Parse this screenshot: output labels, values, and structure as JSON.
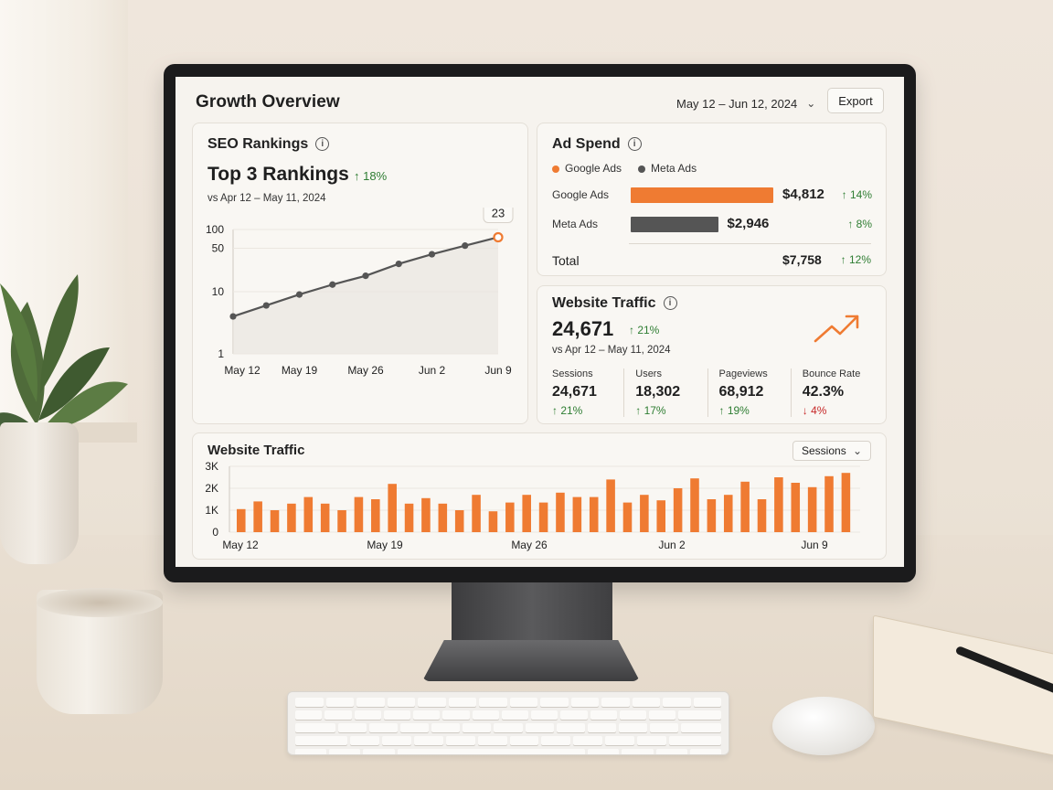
{
  "header": {
    "title": "Growth Overview",
    "date_range": "May 12 – Jun 12, 2024",
    "export_label": "Export"
  },
  "seo": {
    "title": "SEO Rankings",
    "headline": "Top 3 Rankings",
    "delta": "↑ 18%",
    "comparison": "vs Apr 12 – May 11, 2024",
    "callout": "23"
  },
  "ad_spend": {
    "title": "Ad Spend",
    "legend": [
      "Google Ads",
      "Meta Ads"
    ],
    "rows": [
      {
        "label": "Google Ads",
        "value": "$4,812",
        "delta": "↑ 14%",
        "amount": 4812,
        "color": "#ef7b32"
      },
      {
        "label": "Meta Ads",
        "value": "$2,946",
        "delta": "↑ 8%",
        "amount": 2946,
        "color": "#555555"
      }
    ],
    "total_label": "Total",
    "total_value": "$7,758",
    "total_delta": "↑ 12%"
  },
  "website_traffic": {
    "title": "Website Traffic",
    "value": "24,671",
    "delta": "↑ 21%",
    "comparison": "vs Apr 12 – May 11, 2024",
    "trend_icon": "trending-up-icon",
    "stats": [
      {
        "label": "Sessions",
        "value": "24,671",
        "delta": "↑ 21%",
        "direction": "up"
      },
      {
        "label": "Users",
        "value": "18,302",
        "delta": "↑ 17%",
        "direction": "up"
      },
      {
        "label": "Pageviews",
        "value": "68,912",
        "delta": "↑ 19%",
        "direction": "up"
      },
      {
        "label": "Bounce Rate",
        "value": "42.3%",
        "delta": "↓ 4%",
        "direction": "down"
      }
    ]
  },
  "traffic_chart": {
    "title": "Website Traffic",
    "metric_select": "Sessions"
  },
  "colors": {
    "accent": "#ef7b32",
    "meta": "#555555",
    "positive": "#2e7d32",
    "negative": "#c62828"
  },
  "chart_data": [
    {
      "type": "line",
      "scale": "log",
      "x": [
        "May 12",
        "",
        "May 19",
        "",
        "May 26",
        "",
        "Jun 2",
        "",
        "Jun 9"
      ],
      "xticks": [
        "May 12",
        "May 19",
        "May 26",
        "Jun 2",
        "Jun 9"
      ],
      "yticks": [
        "100",
        "50",
        "10",
        "1"
      ],
      "ylim": [
        1,
        100
      ],
      "values": [
        4,
        6,
        9,
        13,
        18,
        28,
        40,
        55,
        75
      ],
      "annotation": "23",
      "grid": true
    },
    {
      "type": "bar",
      "yticks": [
        "3K",
        "2K",
        "1K",
        "0"
      ],
      "ylim": [
        0,
        3000
      ],
      "xticks": [
        "May 12",
        "May 19",
        "May 26",
        "Jun 2",
        "Jun 9"
      ],
      "values": [
        1050,
        1400,
        1000,
        1300,
        1600,
        1300,
        1000,
        1600,
        1500,
        2200,
        1300,
        1550,
        1300,
        1000,
        1700,
        950,
        1350,
        1700,
        1350,
        1800,
        1600,
        1600,
        2400,
        1350,
        1700,
        1450,
        2000,
        2450,
        1500,
        1700,
        2300,
        1500,
        2500,
        2250,
        2050,
        2550,
        2700
      ]
    }
  ]
}
